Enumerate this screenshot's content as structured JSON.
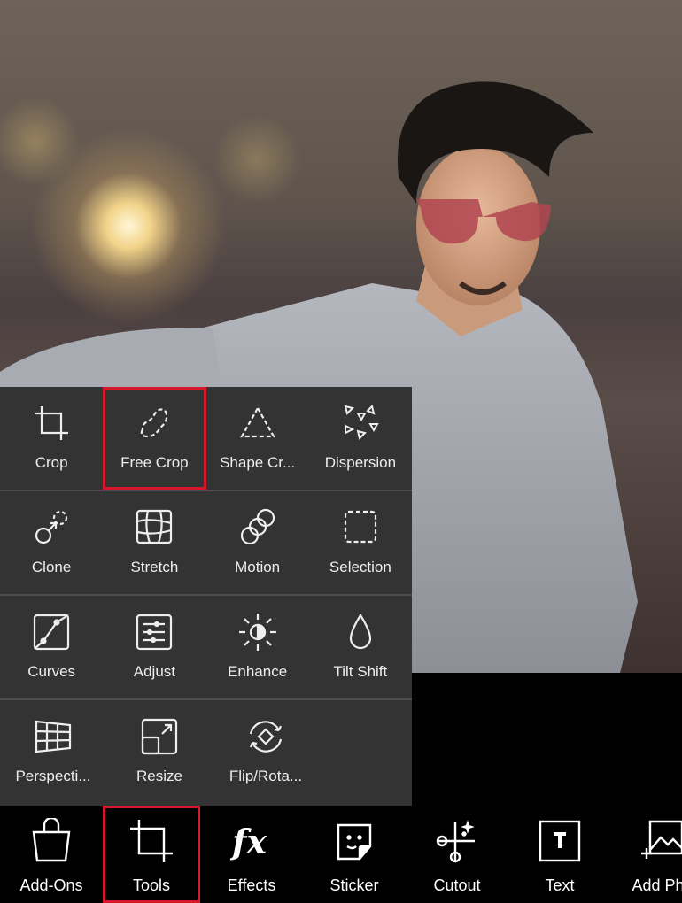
{
  "tools_panel": {
    "items": [
      {
        "label": "Crop",
        "icon": "crop-icon"
      },
      {
        "label": "Free Crop",
        "icon": "free-crop-icon",
        "highlighted": true
      },
      {
        "label": "Shape Cr...",
        "icon": "shape-crop-icon"
      },
      {
        "label": "Dispersion",
        "icon": "dispersion-icon"
      },
      {
        "label": "Clone",
        "icon": "clone-icon"
      },
      {
        "label": "Stretch",
        "icon": "stretch-icon"
      },
      {
        "label": "Motion",
        "icon": "motion-icon"
      },
      {
        "label": "Selection",
        "icon": "selection-icon"
      },
      {
        "label": "Curves",
        "icon": "curves-icon"
      },
      {
        "label": "Adjust",
        "icon": "adjust-icon"
      },
      {
        "label": "Enhance",
        "icon": "enhance-icon"
      },
      {
        "label": "Tilt Shift",
        "icon": "tilt-shift-icon"
      },
      {
        "label": "Perspecti...",
        "icon": "perspective-icon"
      },
      {
        "label": "Resize",
        "icon": "resize-icon"
      },
      {
        "label": "Flip/Rota...",
        "icon": "flip-rotate-icon"
      }
    ]
  },
  "bottom_bar": {
    "items": [
      {
        "label": "Add-Ons",
        "icon": "shopping-bag-icon"
      },
      {
        "label": "Tools",
        "icon": "crop-icon",
        "selected": true
      },
      {
        "label": "Effects",
        "icon": "fx-icon"
      },
      {
        "label": "Sticker",
        "icon": "sticker-icon"
      },
      {
        "label": "Cutout",
        "icon": "scissors-icon"
      },
      {
        "label": "Text",
        "icon": "text-icon"
      },
      {
        "label": "Add Pho",
        "icon": "add-photo-icon"
      }
    ]
  },
  "colors": {
    "highlight": "#d6182a",
    "panel": "#333333"
  }
}
